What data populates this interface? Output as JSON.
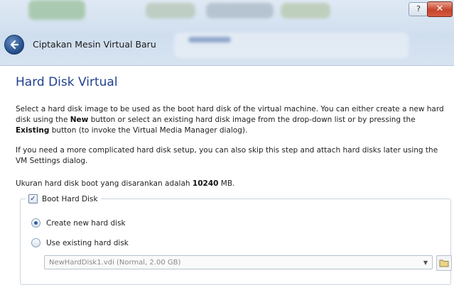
{
  "window": {
    "help_label": "?",
    "close_label": "✕"
  },
  "wizard": {
    "title": "Ciptakan Mesin Virtual Baru"
  },
  "page": {
    "heading": "Hard Disk Virtual",
    "intro": {
      "part1": "Select a hard disk image to be used as the boot hard disk of the virtual machine. You can either create a new hard disk using the ",
      "new_kw": "New",
      "part2": " button or select an existing hard disk image from the drop-down list or by pressing the ",
      "existing_kw": "Existing",
      "part3": " button (to invoke the Virtual Media Manager dialog)."
    },
    "complex_setup": "If you need a more complicated hard disk setup, you can also skip this step and attach hard disks later using the VM Settings dialog.",
    "recommended": {
      "prefix": "Ukuran hard disk boot yang disarankan adalah ",
      "size": "10240",
      "unit": " MB."
    }
  },
  "boot_group": {
    "checkbox_label": "Boot Hard Disk",
    "checked": true,
    "options": [
      {
        "label": "Create new hard disk",
        "selected": true
      },
      {
        "label": "Use existing hard disk",
        "selected": false
      }
    ],
    "existing_disk_value": "NewHardDisk1.vdi (Normal, 2.00 GB)"
  }
}
